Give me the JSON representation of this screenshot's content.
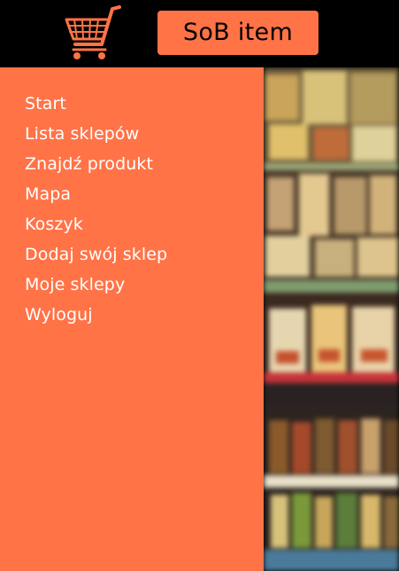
{
  "header": {
    "title": "SoB item",
    "logo_icon": "shopping-cart-icon"
  },
  "sidebar": {
    "items": [
      {
        "label": "Start"
      },
      {
        "label": "Lista sklepów"
      },
      {
        "label": "Znajdź produkt"
      },
      {
        "label": "Mapa"
      },
      {
        "label": "Koszyk"
      },
      {
        "label": "Dodaj swój sklep"
      },
      {
        "label": "Moje sklepy"
      },
      {
        "label": "Wyloguj"
      }
    ]
  },
  "colors": {
    "accent": "#ff7347",
    "header_bg": "#000000",
    "menu_text": "#ffffff"
  }
}
